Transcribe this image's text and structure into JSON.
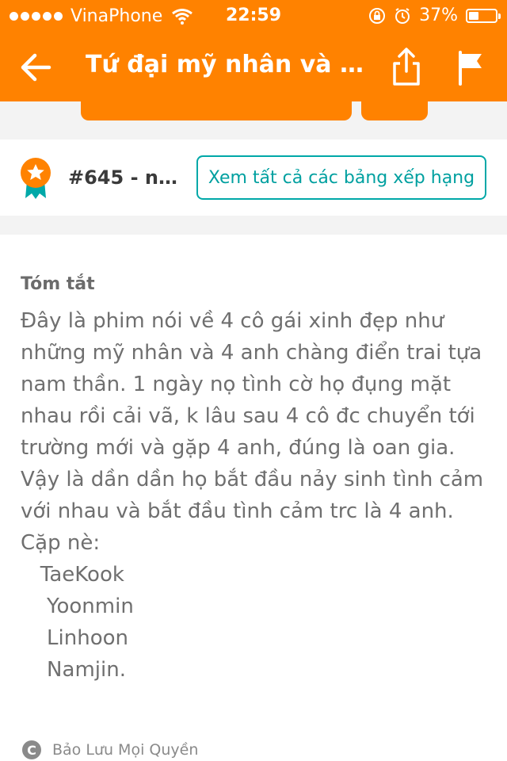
{
  "status_bar": {
    "carrier": "VinaPhone",
    "time": "22:59",
    "battery_percent_label": "37%",
    "battery_level": 0.37
  },
  "nav": {
    "title": "Tứ đại mỹ nhân và tứ..."
  },
  "ranking": {
    "rank_label": "#645 - na...",
    "view_all_button": "Xem tất cả các bảng xếp hạng"
  },
  "summary": {
    "heading": "Tóm tắt",
    "lines": [
      "Đây là phim nói về 4  cô gái xinh đẹp như",
      "những mỹ nhân và 4 anh chàng điển trai tựa",
      "nam thần. 1 ngày nọ tình cờ họ đụng mặt",
      "nhau rồi cải vã, k lâu sau 4 cô đc chuyển tới",
      "trường mới và gặp 4 anh, đúng là oan gia.",
      "Vậy là dần dần họ bắt đầu nảy sinh tình cảm",
      "với nhau và bắt đầu tình cảm trc là 4 anh.",
      "Cặp nè:"
    ],
    "pairs": [
      "   TaeKook",
      "    Yoonmin",
      "    Linhoon",
      "    Namjin."
    ]
  },
  "footer": {
    "copyright_label": "Bảo Lưu Mọi Quyền"
  },
  "colors": {
    "accent": "#ff8200",
    "teal": "#00a8a8"
  },
  "icons": [
    "wifi-icon",
    "lock-rotation-icon",
    "alarm-icon",
    "battery-icon",
    "back-arrow-icon",
    "share-icon",
    "flag-icon",
    "ranking-badge-icon",
    "copyright-icon"
  ]
}
